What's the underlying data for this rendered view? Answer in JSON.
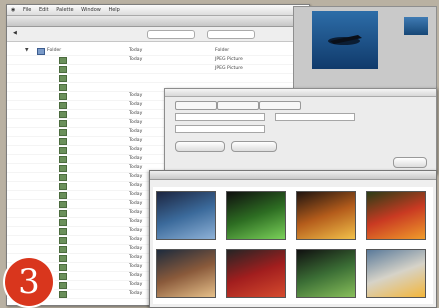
{
  "menubar": [
    "",
    "File",
    "Edit",
    "Palette",
    "Window",
    "Help"
  ],
  "finder": {
    "title": "",
    "path": "",
    "rows": [
      {
        "name": "Folder",
        "date": "Today",
        "size": "",
        "kind": "Folder"
      },
      {
        "name": "",
        "date": "Today",
        "size": "",
        "kind": "JPEG Picture"
      },
      {
        "name": "",
        "date": "",
        "size": "",
        "kind": "JPEG Picture"
      },
      {
        "name": "",
        "date": "",
        "size": "",
        "kind": ""
      },
      {
        "name": "",
        "date": "",
        "size": "",
        "kind": ""
      },
      {
        "name": "",
        "date": "Today",
        "size": "",
        "kind": ""
      },
      {
        "name": "",
        "date": "Today",
        "size": "",
        "kind": ""
      },
      {
        "name": "",
        "date": "Today",
        "size": "",
        "kind": ""
      },
      {
        "name": "",
        "date": "Today",
        "size": "",
        "kind": ""
      },
      {
        "name": "",
        "date": "Today",
        "size": "",
        "kind": ""
      },
      {
        "name": "",
        "date": "Today",
        "size": "",
        "kind": ""
      },
      {
        "name": "",
        "date": "Today",
        "size": "",
        "kind": ""
      },
      {
        "name": "",
        "date": "Today",
        "size": "",
        "kind": ""
      },
      {
        "name": "",
        "date": "Today",
        "size": "",
        "kind": ""
      },
      {
        "name": "",
        "date": "Today",
        "size": "",
        "kind": ""
      },
      {
        "name": "",
        "date": "Today",
        "size": "",
        "kind": ""
      },
      {
        "name": "",
        "date": "Today",
        "size": "",
        "kind": ""
      },
      {
        "name": "",
        "date": "Today",
        "size": "",
        "kind": ""
      },
      {
        "name": "",
        "date": "Today",
        "size": "",
        "kind": ""
      },
      {
        "name": "",
        "date": "Today",
        "size": "",
        "kind": ""
      },
      {
        "name": "",
        "date": "Today",
        "size": "",
        "kind": ""
      },
      {
        "name": "",
        "date": "Today",
        "size": "",
        "kind": ""
      },
      {
        "name": "",
        "date": "Today",
        "size": "",
        "kind": ""
      },
      {
        "name": "",
        "date": "Today",
        "size": "",
        "kind": ""
      },
      {
        "name": "",
        "date": "Today",
        "size": "",
        "kind": ""
      },
      {
        "name": "",
        "date": "Today",
        "size": "",
        "kind": ""
      },
      {
        "name": "",
        "date": "Today",
        "size": "",
        "kind": ""
      },
      {
        "name": "",
        "date": "Today",
        "size": "",
        "kind": ""
      }
    ]
  },
  "dialog": {
    "title": "",
    "tabs": [
      "",
      "",
      ""
    ],
    "fields": [
      "",
      "",
      ""
    ],
    "buttons": [
      "",
      "",
      ""
    ]
  },
  "browser": {
    "title": "",
    "images": [
      {
        "caption": "",
        "colors": [
          "#1c2540",
          "#3b6a9b",
          "#8fb2d7"
        ]
      },
      {
        "caption": "",
        "colors": [
          "#0f0f0f",
          "#2d6d22",
          "#7bd15a"
        ]
      },
      {
        "caption": "",
        "colors": [
          "#201510",
          "#b45c1b",
          "#f2c14a"
        ]
      },
      {
        "caption": "",
        "colors": [
          "#2b3d16",
          "#c93a22",
          "#f09c2b"
        ]
      },
      {
        "caption": "",
        "colors": [
          "#1d2b3d",
          "#8a5a3b",
          "#e6c08a"
        ]
      },
      {
        "caption": "",
        "colors": [
          "#252525",
          "#a21e1e",
          "#d54b2e"
        ]
      },
      {
        "caption": "",
        "colors": [
          "#101010",
          "#3b6e35",
          "#88bf5a"
        ]
      },
      {
        "caption": "",
        "colors": [
          "#5a7a9a",
          "#d6d3c8",
          "#f3b63a"
        ]
      }
    ]
  },
  "badge": "3"
}
